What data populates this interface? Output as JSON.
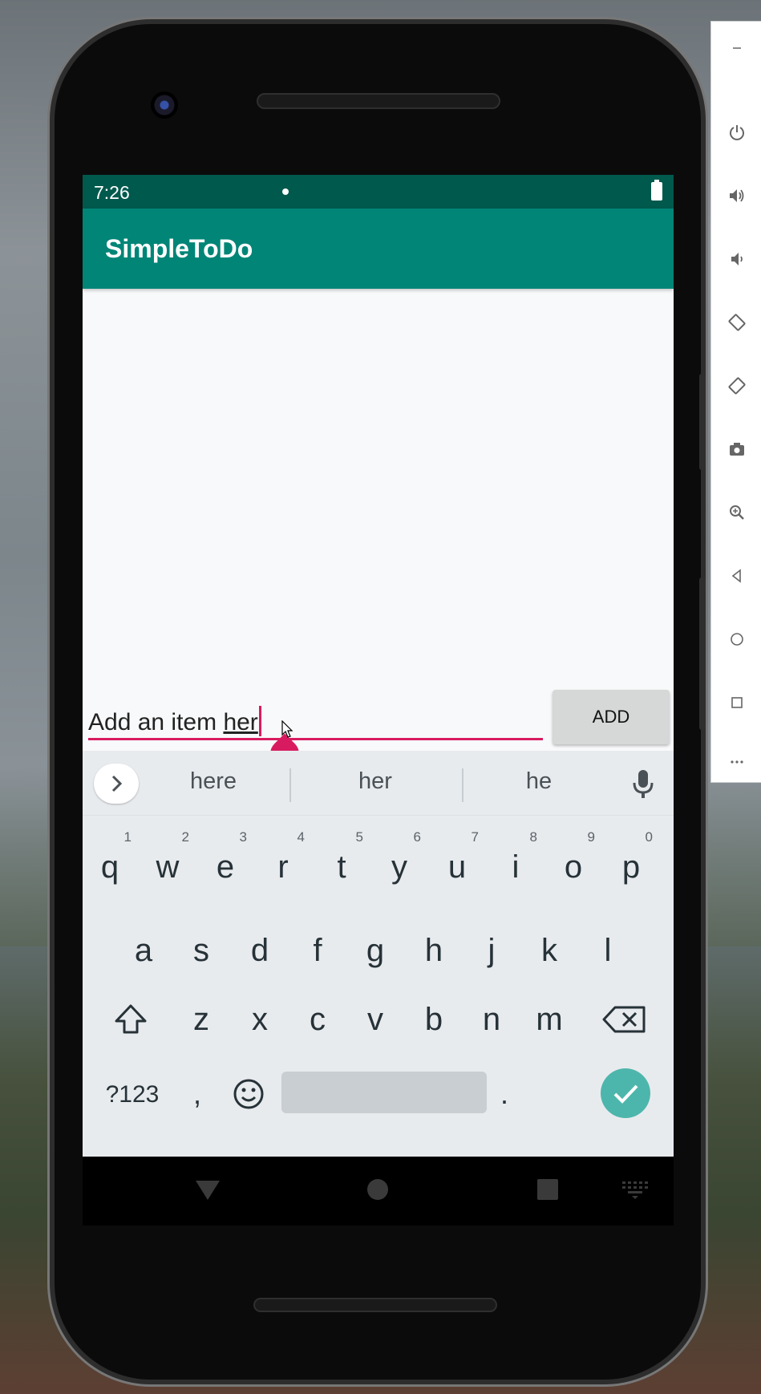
{
  "status_bar": {
    "time": "7:26"
  },
  "app_bar": {
    "title": "SimpleToDo"
  },
  "input": {
    "prefix_text": "Add an item ",
    "composing_text": "her"
  },
  "add_button": {
    "label": "ADD"
  },
  "keyboard": {
    "suggestions": [
      "here",
      "her",
      "he"
    ],
    "row1": [
      {
        "key": "q",
        "hint": "1"
      },
      {
        "key": "w",
        "hint": "2"
      },
      {
        "key": "e",
        "hint": "3"
      },
      {
        "key": "r",
        "hint": "4"
      },
      {
        "key": "t",
        "hint": "5"
      },
      {
        "key": "y",
        "hint": "6"
      },
      {
        "key": "u",
        "hint": "7"
      },
      {
        "key": "i",
        "hint": "8"
      },
      {
        "key": "o",
        "hint": "9"
      },
      {
        "key": "p",
        "hint": "0"
      }
    ],
    "row2": [
      "a",
      "s",
      "d",
      "f",
      "g",
      "h",
      "j",
      "k",
      "l"
    ],
    "row3": [
      "z",
      "x",
      "c",
      "v",
      "b",
      "n",
      "m"
    ],
    "symbols_label": "?123",
    "comma_label": ",",
    "period_label": "."
  },
  "colors": {
    "status_bar": "#00594d",
    "app_bar": "#008577",
    "accent": "#d81b60",
    "enter_key": "#4db6ac",
    "keyboard_bg": "#e8ebee"
  },
  "icons": {
    "keyboard": [
      "chevron-right-icon",
      "microphone-icon",
      "shift-icon",
      "backspace-icon",
      "emoji-icon",
      "check-icon"
    ],
    "navigation": [
      "back-icon",
      "home-icon",
      "recents-icon",
      "keyboard-switch-icon"
    ],
    "emulator_panel": [
      "minimize-icon",
      "power-icon",
      "volume-up-icon",
      "volume-down-icon",
      "rotate-left-icon",
      "rotate-right-icon",
      "camera-icon",
      "zoom-icon",
      "back-icon",
      "home-icon",
      "overview-icon",
      "more-icon"
    ]
  }
}
